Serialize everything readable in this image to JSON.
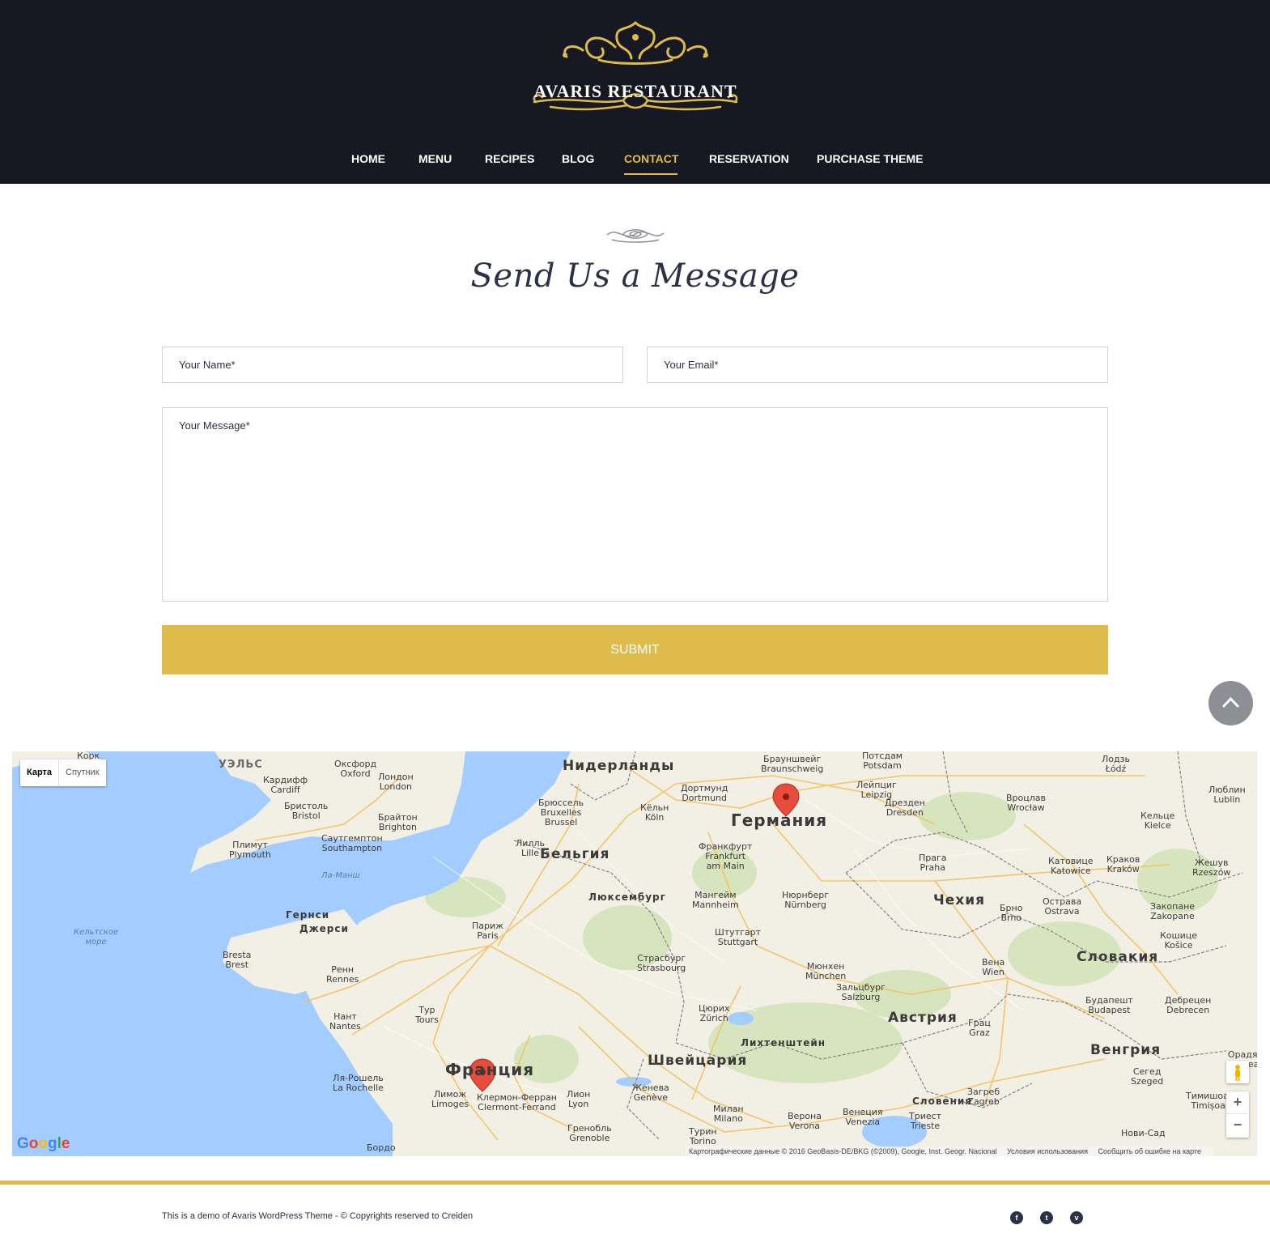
{
  "header": {
    "brand": "AVARIS RESTAURANT",
    "nav": [
      {
        "label": "HOME",
        "active": false
      },
      {
        "label": "MENU",
        "active": false
      },
      {
        "label": "RECIPES",
        "active": false
      },
      {
        "label": "BLOG",
        "active": false
      },
      {
        "label": "CONTACT",
        "active": true
      },
      {
        "label": "RESERVATION",
        "active": false
      },
      {
        "label": "PURCHASE THEME",
        "active": false
      }
    ]
  },
  "contact": {
    "title": "Send Us a Message",
    "name_placeholder": "Your Name*",
    "email_placeholder": "Your Email*",
    "message_placeholder": "Your Message*",
    "submit_label": "SUBMIT"
  },
  "map": {
    "type_controls": {
      "map": "Карта",
      "satellite": "Спутник"
    },
    "zoom_in": "+",
    "zoom_out": "−",
    "google_logo": "Google",
    "attribution": "Картографические данные © 2016 GeoBasis-DE/BKG (©2009), Google, Inst. Geogr. Nacional",
    "terms": "Условия использования",
    "report": "Сообщить об ошибке на карте",
    "countries": [
      "Нидерланды",
      "Германия",
      "Бельгия",
      "Люксембург",
      "Чехия",
      "Словакия",
      "Австрия",
      "Венгрия",
      "Франция",
      "Швейцария",
      "Лихтенштейн",
      "Словения",
      "УЭЛЬС",
      "Гернси",
      "Джерси"
    ],
    "cities": [
      "Корк",
      "Оксфорд\nOxford",
      "Лондон\nLondon",
      "Кардифф\nCardiff",
      "Бристоль\nBristol",
      "Брайтон\nBrighton",
      "Саутгемптон\nSouthampton",
      "Плимут\nPlymouth",
      "Брюссель\nBruxelles\nBrussel",
      "Лилль\nLille",
      "Кёльн\nKöln",
      "Дортмунд\nDortmund",
      "Брауншвейг\nBraunschweig",
      "Потсдам\nPotsdam",
      "Лейпциг\nLeipzig",
      "Дрезден\nDresden",
      "Франкфурт\nFrankfurt\nam Main",
      "Мангейм\nMannheim",
      "Нюрнберг\nNürnberg",
      "Штутгарт\nStuttgart",
      "Страсбург\nStrasbourg",
      "Мюнхен\nMünchen",
      "Зальцбург\nSalzburg",
      "Цюрих\nZürich",
      "Прага\nPraha",
      "Брно\nBrno",
      "Вена\nWien",
      "Острава\nOstrava",
      "Катовице\nKatowice",
      "Краков\nKraków",
      "Лодзь\nŁódź",
      "Вроцлав\nWrocław",
      "Кельце\nKielce",
      "Люблин\nLublin",
      "Жешув\nRzeszów",
      "Закопане\nZakopane",
      "Кошице\nKošice",
      "Будапешт\nBudapest",
      "Дебрецен\nDebrecen",
      "Грац\nGraz",
      "Загреб\nZagreb",
      "Триест\nTrieste",
      "Венеция\nVenezia",
      "Верона\nVerona",
      "Милан\nMilano",
      "Турин\nTorino",
      "Женева\nGenève",
      "Лион\nLyon",
      "Гренобль\nGrenoble",
      "Клермон-Ферран\nClermont-Ferrand",
      "Лимож\nLimoges",
      "Ля-Рошель\nLa Rochelle",
      "Бордо",
      "Нант\nNantes",
      "Тур\nTours",
      "Ренн\nRennes",
      "Bresta\nBrest",
      "Париж\nParis",
      "Сегед\nSzeged",
      "Тимишоара\nTimișoara",
      "Орадя\nOradea",
      "Нови-Сад"
    ],
    "seas": [
      "Ла-Манш",
      "Кельтское\nморе"
    ]
  },
  "footer": {
    "text": "This is a demo of Avaris WordPress Theme - © Copyrights reserved to Creiden",
    "social": [
      {
        "name": "facebook",
        "glyph": "f"
      },
      {
        "name": "twitter",
        "glyph": "t"
      },
      {
        "name": "vimeo",
        "glyph": "v"
      }
    ]
  },
  "colors": {
    "header_bg": "#161922",
    "accent": "#dfbb4b",
    "text_dark": "#2b3146",
    "water": "#a3ccff",
    "land": "#f2efe4",
    "marker": "#e74c3c"
  }
}
